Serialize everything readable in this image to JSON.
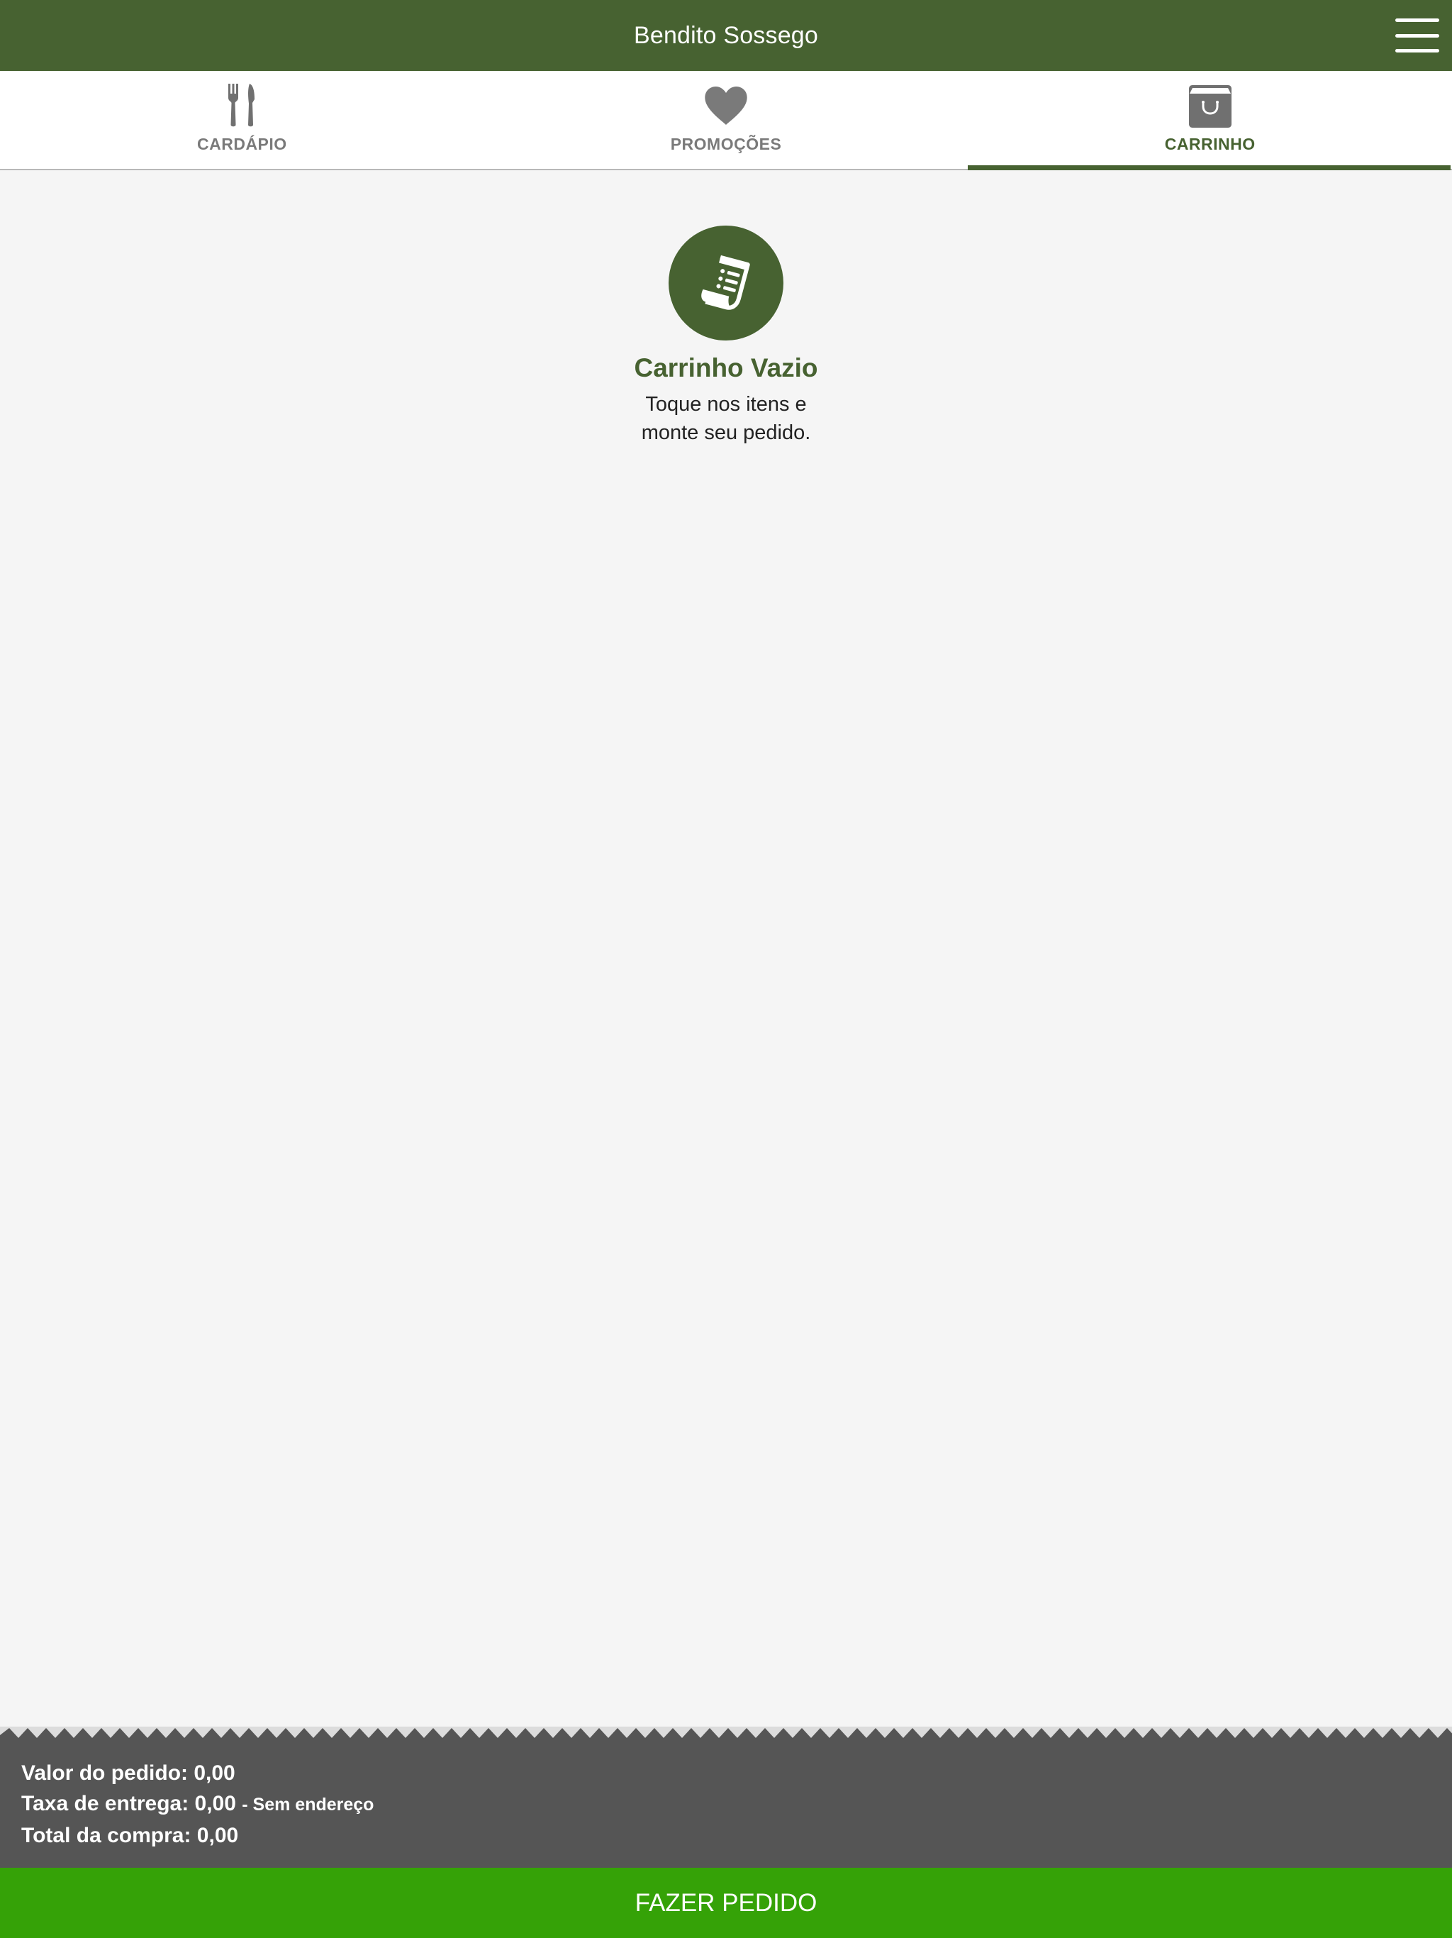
{
  "header": {
    "title": "Bendito Sossego",
    "menu_icon": "hamburger-menu-icon"
  },
  "tabs": [
    {
      "label": "CARDÁPIO",
      "icon": "fork-knife-icon",
      "active": false
    },
    {
      "label": "PROMOÇÕES",
      "icon": "heart-icon",
      "active": false
    },
    {
      "label": "CARRINHO",
      "icon": "shopping-bag-icon",
      "active": true
    }
  ],
  "empty_cart": {
    "icon": "receipt-icon",
    "title": "Carrinho Vazio",
    "subtitle": "Toque nos itens e monte seu pedido."
  },
  "summary": {
    "order_value_label": "Valor do pedido: 0,00",
    "delivery_fee_label": "Taxa de entrega: 0,00",
    "delivery_note": "- Sem endereço",
    "total_label": "Total da compra: 0,00"
  },
  "order_button": {
    "label": "FAZER PEDIDO"
  },
  "colors": {
    "primary": "#476231",
    "inactive": "#7a7a7a",
    "summary_bg": "#555555",
    "button_green": "#35a207",
    "background": "#f5f5f5"
  }
}
